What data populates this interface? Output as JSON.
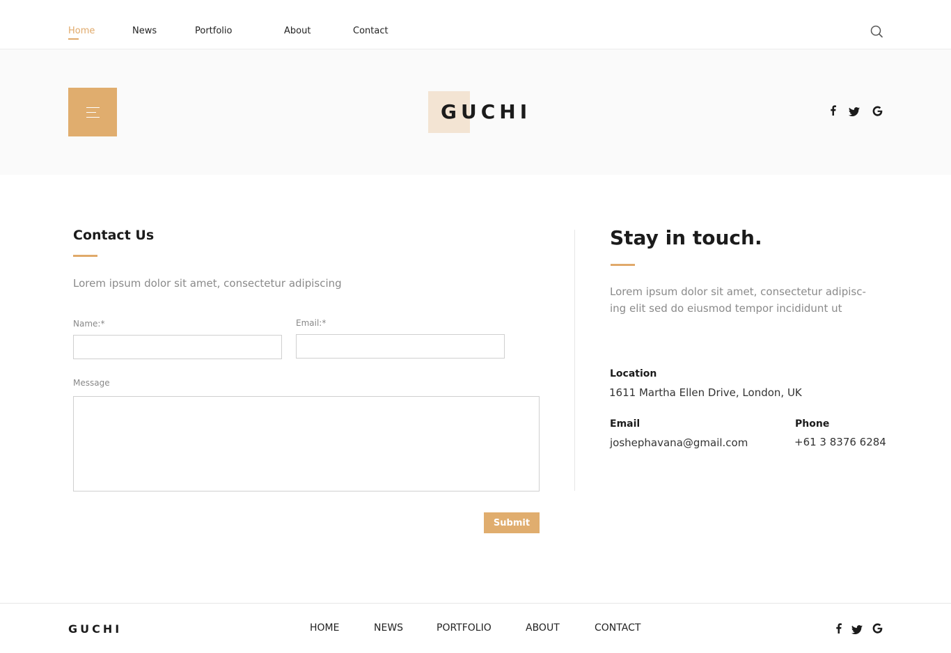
{
  "topnav": {
    "links": [
      "Home",
      "News",
      "Portfolio",
      "About",
      "Contact"
    ],
    "active_index": 0,
    "search_icon": "search-icon"
  },
  "hero": {
    "logo": "GUCHI",
    "menu_icon": "hamburger-menu-icon",
    "social": [
      "facebook-icon",
      "twitter-icon",
      "google-icon"
    ]
  },
  "contact": {
    "title": "Contact Us",
    "lead": "Lorem ipsum dolor sit amet, consectetur adipiscing",
    "name_label": "Name:*",
    "email_label": "Email:*",
    "message_label": "Message",
    "name_value": "",
    "email_value": "",
    "message_value": "",
    "submit_label": "Submit"
  },
  "stay": {
    "title": "Stay in touch.",
    "lead_line1": "Lorem ipsum dolor sit amet, consectetur adipisc-",
    "lead_line2": "ing elit sed do eiusmod tempor incididunt ut",
    "location_label": "Location",
    "location_value": "1611  Martha Ellen Drive, London, UK",
    "email_label": "Email",
    "email_value": "joshephavana@gmail.com",
    "phone_label": "Phone",
    "phone_value": "+61 3 8376 6284"
  },
  "footer": {
    "logo": "GUCHI",
    "links": [
      "HOME",
      "NEWS",
      "PORTFOLIO",
      "ABOUT",
      "CONTACT"
    ],
    "social": [
      "facebook-icon",
      "twitter-icon",
      "google-icon"
    ]
  },
  "colors": {
    "accent": "#e0ad6e",
    "logo_block": "#f3e4d3",
    "hero_bg": "#fafafa"
  }
}
